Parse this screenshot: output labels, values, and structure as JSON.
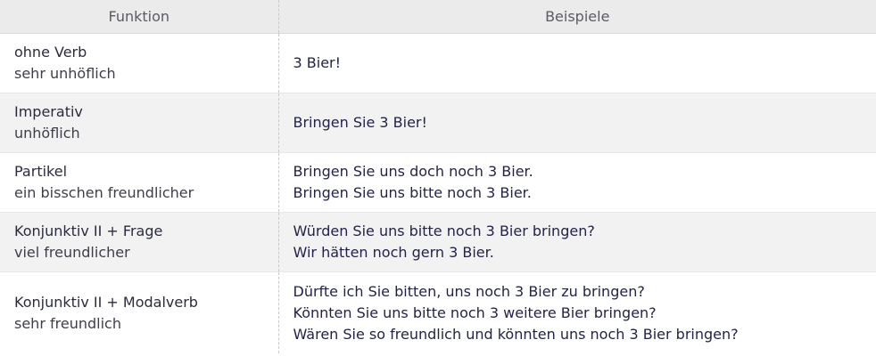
{
  "header": {
    "col_function": "Funktion",
    "col_examples": "Beispiele"
  },
  "rows": [
    {
      "function": "ohne Verb",
      "description": "sehr unhöflich",
      "examples": [
        "3 Bier!"
      ]
    },
    {
      "function": "Imperativ",
      "description": "unhöflich",
      "examples": [
        "Bringen Sie 3 Bier!"
      ]
    },
    {
      "function": "Partikel",
      "description": "ein bisschen freundlicher",
      "examples": [
        "Bringen Sie uns doch noch 3 Bier.",
        "Bringen Sie uns bitte noch 3 Bier."
      ]
    },
    {
      "function": "Konjunktiv II + Frage",
      "description": "viel freundlicher",
      "examples": [
        "Würden Sie uns bitte noch 3 Bier bringen?",
        "Wir hätten noch gern 3 Bier."
      ]
    },
    {
      "function": "Konjunktiv II + Modalverb",
      "description": "sehr freundlich",
      "examples": [
        "Dürfte ich Sie bitten, uns noch 3 Bier zu bringen?",
        "Könnten Sie uns bitte noch 3 weitere Bier bringen?",
        "Wären Sie so freundlich und könnten uns noch 3 Bier bringen?"
      ]
    }
  ]
}
